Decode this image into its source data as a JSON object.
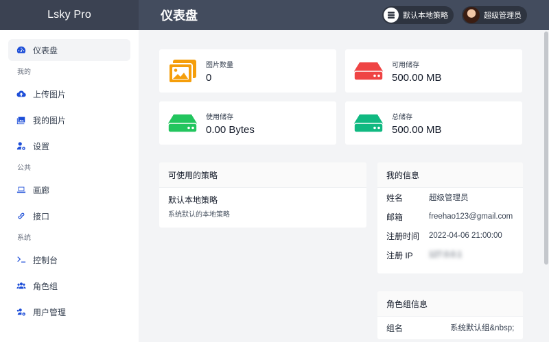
{
  "app": {
    "brand": "Lsky Pro",
    "page_title": "仪表盘"
  },
  "header": {
    "strategy_chip": "默认本地策略",
    "user_chip": "超级管理员"
  },
  "sidebar": {
    "items": [
      {
        "label": "仪表盘"
      },
      {
        "section": "我的"
      },
      {
        "label": "上传图片"
      },
      {
        "label": "我的图片"
      },
      {
        "label": "设置"
      },
      {
        "section": "公共"
      },
      {
        "label": "画廊"
      },
      {
        "label": "接口"
      },
      {
        "section": "系统"
      },
      {
        "label": "控制台"
      },
      {
        "label": "角色组"
      },
      {
        "label": "用户管理"
      }
    ]
  },
  "stats": [
    {
      "label": "图片数量",
      "value": "0",
      "color": "#f59e0b",
      "icon": "images-icon"
    },
    {
      "label": "可用储存",
      "value": "500.00 MB",
      "color": "#ef4444",
      "icon": "hdd-icon"
    },
    {
      "label": "使用储存",
      "value": "0.00 Bytes",
      "color": "#22c55e",
      "icon": "hdd-icon"
    },
    {
      "label": "总储存",
      "value": "500.00 MB",
      "color": "#10b981",
      "icon": "hdd-icon"
    }
  ],
  "policies": {
    "title": "可使用的策略",
    "items": [
      {
        "name": "默认本地策略",
        "desc": "系统默认的本地策略"
      }
    ]
  },
  "my_info": {
    "title": "我的信息",
    "rows": [
      {
        "key": "姓名",
        "value": "超级管理员"
      },
      {
        "key": "邮箱",
        "value": "freehao123@gmail.com"
      },
      {
        "key": "注册时间",
        "value": "2022-04-06 21:00:00"
      },
      {
        "key": "注册 IP",
        "value": "127.0.0.1"
      }
    ]
  },
  "role_info": {
    "title": "角色组信息",
    "rows": [
      {
        "key": "组名",
        "value": "系统默认组&nbsp;"
      }
    ]
  }
}
